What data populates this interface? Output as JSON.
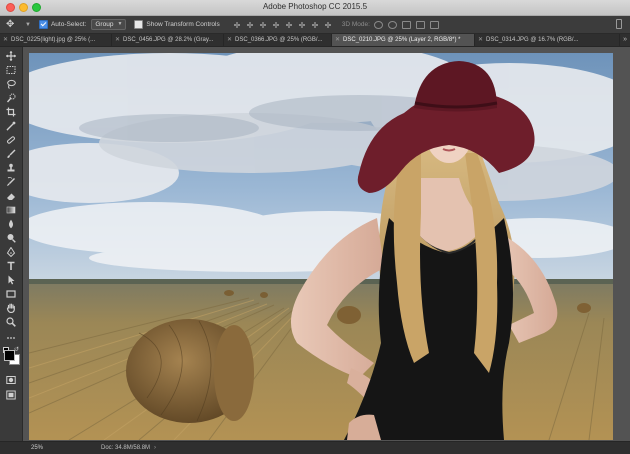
{
  "window": {
    "title": "Adobe Photoshop CC 2015.5"
  },
  "options": {
    "auto_select_label": "Auto-Select:",
    "auto_select_checked": true,
    "auto_select_value": "Group",
    "transform_label": "Show Transform Controls",
    "transform_checked": false,
    "mode_3d_label": "3D Mode:"
  },
  "tabs": [
    {
      "label": "DSC_0225(light).jpg @ 25% (...",
      "active": false
    },
    {
      "label": "DSC_0456.JPG @ 28.2% (Gray...",
      "active": false
    },
    {
      "label": "DSC_0366.JPG @ 25% (RGB/...",
      "active": false
    },
    {
      "label": "DSC_0210.JPG @ 25% (Layer 2, RGB/8*) *",
      "active": true
    },
    {
      "label": "DSC_0314.JPG @ 16.7% (RGB/...",
      "active": false
    }
  ],
  "tab_overflow": "»",
  "status": {
    "zoom": "25%",
    "doc": "Doc: 34.8M/58.8M",
    "arrow": "›"
  },
  "tools": [
    "move-tool",
    "marquee-tool",
    "lasso-tool",
    "quick-select-tool",
    "crop-tool",
    "eyedropper-tool",
    "healing-brush-tool",
    "brush-tool",
    "clone-stamp-tool",
    "history-brush-tool",
    "eraser-tool",
    "gradient-tool",
    "blur-tool",
    "dodge-tool",
    "pen-tool",
    "type-tool",
    "path-select-tool",
    "rectangle-tool",
    "hand-tool",
    "zoom-tool",
    "edit-toolbar",
    "color-swatches",
    "quick-mask",
    "screen-mode"
  ],
  "colors": {
    "hat": "#6e1e2b",
    "dress": "#141414",
    "sky": "#7ea4c9",
    "field": "#a98a55"
  }
}
